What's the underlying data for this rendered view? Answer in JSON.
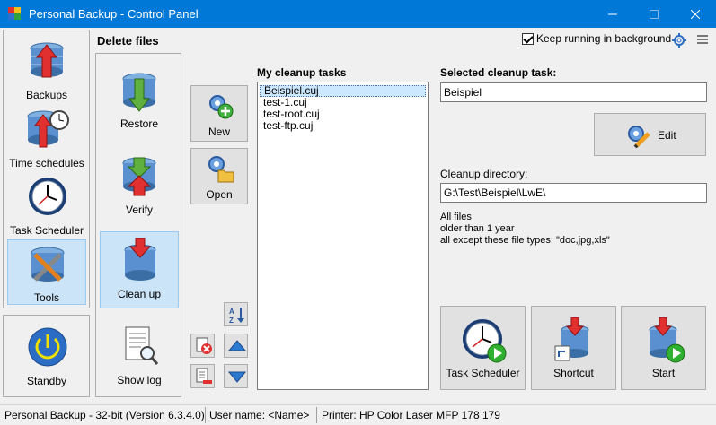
{
  "window": {
    "title": "Personal Backup - Control Panel"
  },
  "nav": {
    "backups": "Backups",
    "time_schedules": "Time schedules",
    "task_scheduler": "Task Scheduler",
    "tools": "Tools",
    "standby": "Standby"
  },
  "tools_menu": {
    "restore": "Restore",
    "verify": "Verify",
    "clean_up": "Clean up",
    "show_log": "Show log"
  },
  "section": {
    "title": "Delete files",
    "keep_running_label": "Keep running in background",
    "keep_running_checked": true
  },
  "task_buttons": {
    "new": "New",
    "open": "Open"
  },
  "tasks": {
    "title": "My cleanup tasks",
    "items": [
      "Beispiel.cuj",
      "test-1.cuj",
      "test-root.cuj",
      "test-ftp.cuj"
    ],
    "selected_index": 0
  },
  "selected": {
    "label": "Selected cleanup task:",
    "value": "Beispiel",
    "edit_label": "Edit",
    "dir_label": "Cleanup directory:",
    "dir_value": "G:\\Test\\Beispiel\\LwE\\",
    "info": [
      "All files",
      "older than 1 year",
      "all except these file types: \"doc,jpg,xls\""
    ]
  },
  "actions": {
    "task_scheduler": "Task Scheduler",
    "shortcut": "Shortcut",
    "start": "Start"
  },
  "status": {
    "version": "Personal Backup - 32-bit (Version 6.3.4.0)",
    "user": "User name: <Name>",
    "printer": "Printer: HP Color Laser MFP 178 179"
  },
  "colors": {
    "titlebar": "#0078d7",
    "selection": "#cce4f7"
  }
}
